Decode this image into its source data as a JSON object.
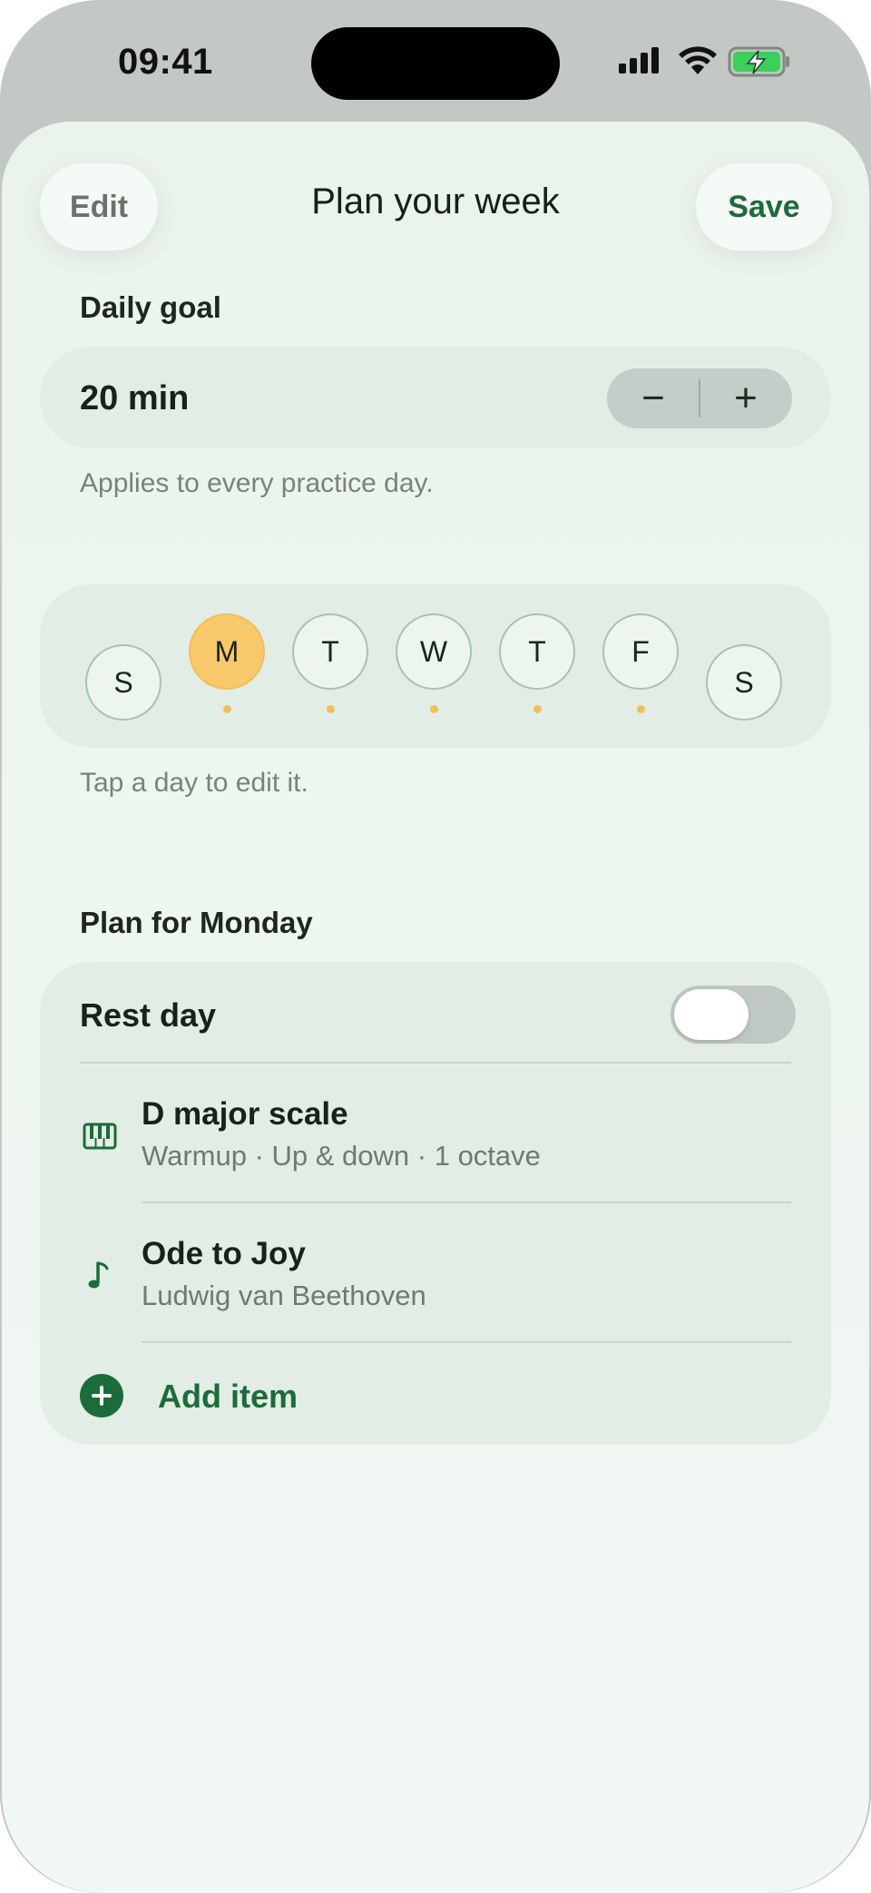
{
  "status_bar": {
    "time": "09:41"
  },
  "header": {
    "edit_label": "Edit",
    "title": "Plan your week",
    "save_label": "Save"
  },
  "daily_goal": {
    "label": "Daily goal",
    "value": "20 min",
    "decrement": "−",
    "increment": "+",
    "hint": "Applies to every practice day."
  },
  "week": {
    "days": [
      {
        "letter": "S",
        "selected": false,
        "has_plan": false
      },
      {
        "letter": "M",
        "selected": true,
        "has_plan": true
      },
      {
        "letter": "T",
        "selected": false,
        "has_plan": true
      },
      {
        "letter": "W",
        "selected": false,
        "has_plan": true
      },
      {
        "letter": "T",
        "selected": false,
        "has_plan": true
      },
      {
        "letter": "F",
        "selected": false,
        "has_plan": true
      },
      {
        "letter": "S",
        "selected": false,
        "has_plan": false
      }
    ],
    "hint": "Tap a day to edit it."
  },
  "plan": {
    "heading": "Plan for Monday",
    "rest_day_label": "Rest day",
    "rest_day_on": false,
    "items": [
      {
        "icon": "piano-icon",
        "title": "D major scale",
        "subtitle": "Warmup · Up & down · 1 octave"
      },
      {
        "icon": "music-note-icon",
        "title": "Ode to Joy",
        "subtitle": "Ludwig van Beethoven"
      }
    ],
    "add_label": "Add item"
  },
  "colors": {
    "accent_green": "#1c6b3a",
    "selected_day": "#f8c96a",
    "battery_green": "#3ccf5a"
  }
}
